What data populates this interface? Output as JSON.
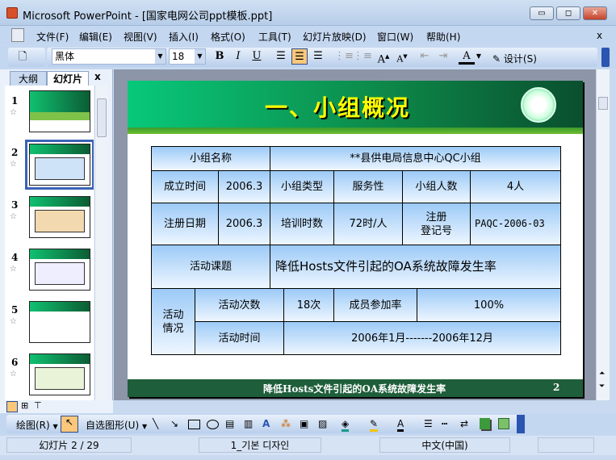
{
  "window": {
    "title": "Microsoft PowerPoint - [国家电网公司ppt模板.ppt]",
    "min": "▭",
    "max": "◻",
    "close": "✕"
  },
  "menu": [
    "文件(F)",
    "编辑(E)",
    "视图(V)",
    "插入(I)",
    "格式(O)",
    "工具(T)",
    "幻灯片放映(D)",
    "窗口(W)",
    "帮助(H)"
  ],
  "menu_close": "x",
  "toolbar": {
    "font": "黑体",
    "size": "18",
    "bold": "B",
    "italic": "I",
    "underline": "U",
    "design": "设计(S)"
  },
  "pane": {
    "tab_outline": "大纲",
    "tab_slides": "幻灯片",
    "close": "x"
  },
  "thumbs": [
    "1",
    "2",
    "3",
    "4",
    "5",
    "6"
  ],
  "slide": {
    "title": "一、小组概况",
    "footer": "降低Hosts文件引起的OA系统故障发生率",
    "page": "2",
    "table": {
      "r1": [
        "小组名称",
        "**县供电局信息中心QC小组"
      ],
      "r2": [
        "成立时间",
        "2006.3",
        "小组类型",
        "服务性",
        "小组人数",
        "4人"
      ],
      "r3": [
        "注册日期",
        "2006.3",
        "培训时数",
        "72时/人",
        "注册\n登记号",
        "PAQC-2006-03"
      ],
      "r4": [
        "活动课题",
        "降低Hosts文件引起的OA系统故障发生率"
      ],
      "r5": [
        "活动\n情况",
        "活动次数",
        "18次",
        "成员参加率",
        "100%"
      ],
      "r6": [
        "活动时间",
        "2006年1月-------2006年12月"
      ]
    }
  },
  "drawbar": {
    "draw": "绘图(R)",
    "autoshapes": "自选图形(U)"
  },
  "status": {
    "slide": "幻灯片 2 / 29",
    "design": "1_기본 디자인",
    "lang": "中文(中国)"
  }
}
